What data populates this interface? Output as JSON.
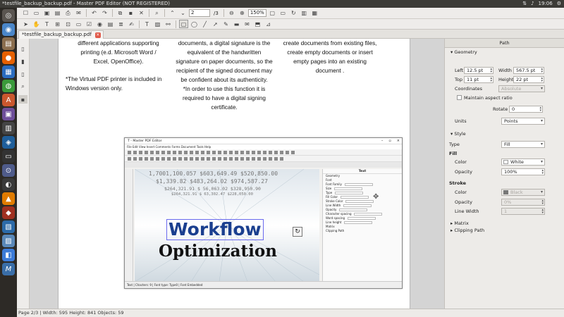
{
  "window": {
    "title": "*testfile_backup_backup.pdf - Master PDF Editor (NOT REGISTERED)",
    "clock": "19:06"
  },
  "launcher": {
    "icons": [
      "dash-icon",
      "chromium-icon",
      "files-icon",
      "firefox-icon",
      "libreoffice-writer-icon",
      "chrome-icon",
      "software-center-icon",
      "app-icon",
      "app-icon",
      "app-icon",
      "terminal-icon",
      "lock-icon",
      "steam-icon",
      "vlc-icon",
      "app-icon",
      "app-icon",
      "app-icon",
      "app-icon",
      "master-pdf-editor-icon"
    ]
  },
  "toolbar": {
    "page_current": "2",
    "page_total": "/3",
    "zoom": "150%"
  },
  "tab": {
    "label": "*testfile_backup_backup.pdf"
  },
  "document": {
    "col1": {
      "p1": "different applications supporting printing (e.d. Microsoft Word / Excel, OpenOffice).",
      "p2": "*The Virtual PDF printer is included in Windows version only."
    },
    "col2": {
      "p1": "documents, a digital signature is the equivalent of the handwritten signature on paper documents, so the recipient of the signed document may be confident about its authenticity.",
      "p2": "*In order to use this function it is required to have a digital signing certificate."
    },
    "col3": {
      "p1": "create documents from existing files, create empty documents or insert empty pages into an existing document ."
    },
    "inner": {
      "title": "T - Master PDF Editor",
      "menu": "File  Edit  View  Insert  Comments  Forms  Document  Tools  Help",
      "panel_title": "Text",
      "panel_rows": [
        "Geometry",
        "Font",
        "Font Family",
        "Size",
        "Type",
        "Fill Color",
        "Stroke Color",
        "Line Width",
        "Opacity",
        "Character spacing",
        "Word spacing",
        "Line height",
        "Matrix",
        "Clipping Path"
      ],
      "status": "Text | Chacters: 9 | Font type: Type0 | Font Embedded",
      "big_text_1": "Workflow",
      "big_text_2": "Optimization",
      "numbers": [
        "1,7001,100.057   $603,649.49   $520,850.00",
        "$1,339.82   $483,264.02   $974,587.27",
        "$264,321.91   $ 56,063.02   $328,950.90",
        "$264,321.91   $ 63,302.47   $228,050.00"
      ]
    }
  },
  "panel": {
    "title": "Path",
    "geometry_label": "Geometry",
    "left_label": "Left",
    "left_value": "12.5 pt",
    "width_label": "Width",
    "width_value": "567.5 pt",
    "top_label": "Top",
    "top_value": "11 pt",
    "height_label": "Height",
    "height_value": "22 pt",
    "coordinates_label": "Coordinates",
    "coordinates_value": "Absolute",
    "aspect_label": "Maintain aspect ratio",
    "rotate_label": "Rotate",
    "rotate_value": "0",
    "units_label": "Units",
    "units_value": "Points",
    "style_label": "Style",
    "type_label": "Type",
    "type_value": "Fill",
    "fill_label": "Fill",
    "fill_color_label": "Color",
    "fill_color_value": "White",
    "fill_opacity_label": "Opacity",
    "fill_opacity_value": "100%",
    "stroke_label": "Stroke",
    "stroke_color_label": "Color",
    "stroke_color_value": "Black",
    "stroke_opacity_label": "Opacity",
    "stroke_opacity_value": "0%",
    "line_width_label": "Line Width",
    "line_width_value": "1",
    "matrix_label": "Matrix",
    "clipping_label": "Clipping Path"
  },
  "status": {
    "text": "Page 2/3 | Width: 595 Height: 841 Objects: 59"
  },
  "colors": {
    "launcher_bg": "#2d2a26",
    "topbar_bg": "#3c3b37",
    "accent_blue": "#1a3f8f"
  }
}
